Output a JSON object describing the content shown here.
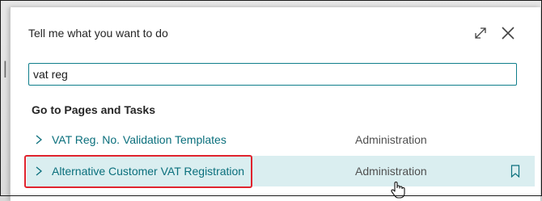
{
  "dialog": {
    "title": "Tell me what you want to do",
    "search": {
      "value": "vat reg",
      "placeholder": ""
    },
    "section_heading": "Go to Pages and Tasks",
    "results": [
      {
        "label": "VAT Reg. No. Validation Templates",
        "category": "Administration",
        "selected": false
      },
      {
        "label": "Alternative Customer VAT Registration",
        "category": "Administration",
        "selected": true
      }
    ]
  },
  "icons": {
    "expand": "expand-icon",
    "close": "close-icon",
    "chevron": "chevron-right-icon",
    "bookmark": "bookmark-icon",
    "cursor": "hand-pointer-cursor"
  },
  "colors": {
    "accent": "#0a6f7c",
    "selected_row": "#daeef0",
    "highlight": "#e0242e"
  }
}
